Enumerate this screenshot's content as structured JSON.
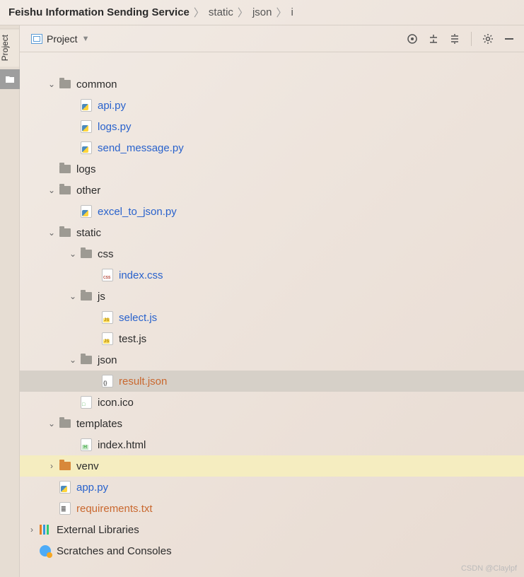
{
  "breadcrumb": {
    "root": "Feishu Information Sending Service",
    "p1": "static",
    "p2": "json",
    "p3": "i"
  },
  "toolbar": {
    "project_label": "Project"
  },
  "tree": {
    "common": "common",
    "api_py": "api.py",
    "logs_py": "logs.py",
    "send_message_py": "send_message.py",
    "logs": "logs",
    "other": "other",
    "excel_to_json_py": "excel_to_json.py",
    "static": "static",
    "css": "css",
    "index_css": "index.css",
    "js": "js",
    "select_js": "select.js",
    "test_js": "test.js",
    "json": "json",
    "result_json": "result.json",
    "icon_ico": "icon.ico",
    "templates": "templates",
    "index_html": "index.html",
    "venv": "venv",
    "app_py": "app.py",
    "requirements_txt": "requirements.txt",
    "external_libraries": "External Libraries",
    "scratches": "Scratches and Consoles"
  },
  "sidebar": {
    "project_tab": "Project"
  },
  "watermark": "CSDN @Claylpf"
}
